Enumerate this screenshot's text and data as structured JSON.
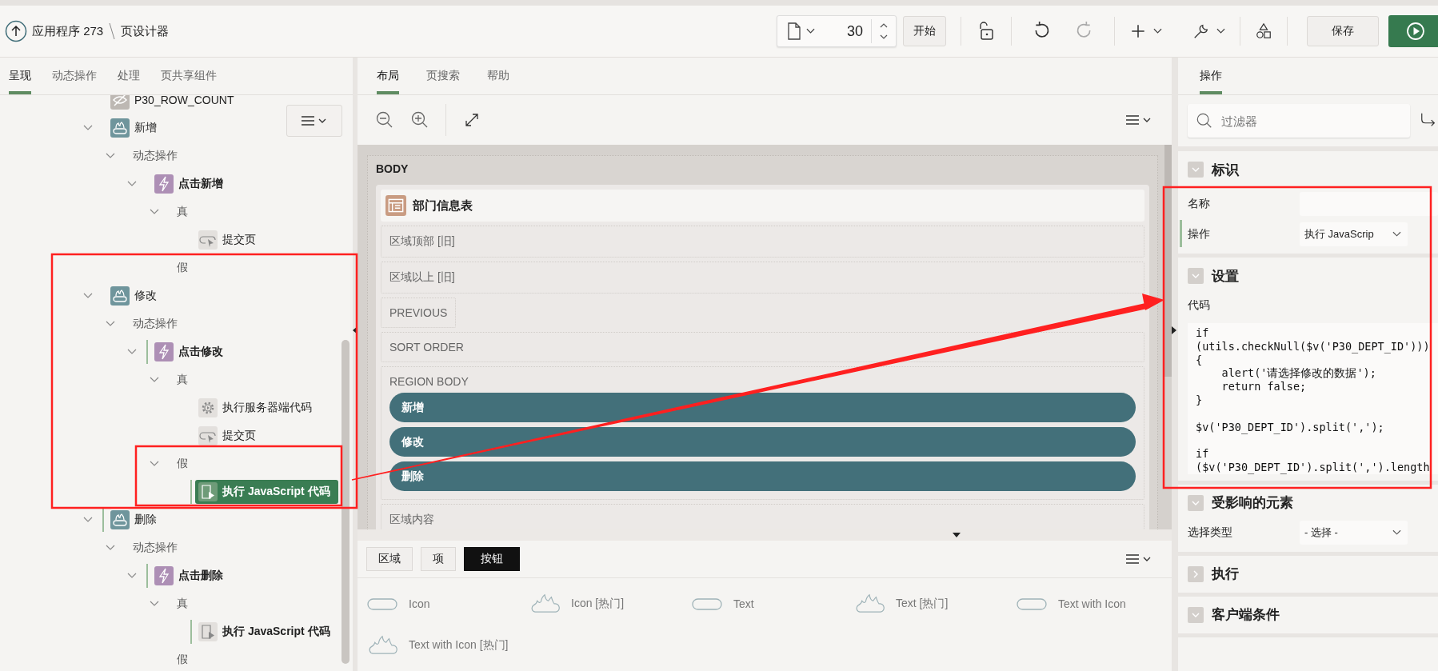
{
  "header": {
    "app": "应用程序 273",
    "page_designer": "页设计器",
    "page_number": "30",
    "start_button": "开始",
    "save_button": "保存",
    "history": [
      {
        "kind": "undo",
        "disabled": false
      },
      {
        "kind": "redo",
        "disabled": true
      }
    ]
  },
  "left_panel": {
    "tabs": [
      {
        "label": "呈现",
        "selected": true
      },
      {
        "label": "动态操作",
        "selected": false
      },
      {
        "label": "处理",
        "selected": false
      },
      {
        "label": "页共享组件",
        "selected": false
      }
    ],
    "tree": [
      {
        "label": "P30_ROW_COUNT",
        "kind": "hidden-item",
        "selected": false,
        "modified": false
      },
      {
        "label": "新增",
        "kind": "button",
        "expanded": true,
        "selected": false,
        "modified": false,
        "children": [
          {
            "label": "动态操作",
            "kind": "folder",
            "expanded": true,
            "selected": false,
            "modified": false,
            "children": [
              {
                "label": "点击新增",
                "kind": "event",
                "expanded": true,
                "selected": false,
                "modified": false,
                "children": [
                  {
                    "label": "真",
                    "kind": "folder",
                    "expanded": true,
                    "selected": false,
                    "modified": false,
                    "children": [
                      {
                        "label": "提交页",
                        "kind": "submit",
                        "selected": false,
                        "modified": false
                      }
                    ]
                  },
                  {
                    "label": "假",
                    "kind": "folder",
                    "selected": false,
                    "modified": false
                  }
                ]
              }
            ]
          }
        ]
      },
      {
        "label": "修改",
        "kind": "button",
        "expanded": true,
        "selected": false,
        "modified": false,
        "children": [
          {
            "label": "动态操作",
            "kind": "folder",
            "expanded": true,
            "selected": false,
            "modified": false,
            "children": [
              {
                "label": "点击修改",
                "kind": "event",
                "expanded": true,
                "selected": false,
                "modified": true,
                "children": [
                  {
                    "label": "真",
                    "kind": "folder",
                    "expanded": true,
                    "selected": false,
                    "modified": false,
                    "children": [
                      {
                        "label": "执行服务器端代码",
                        "kind": "server",
                        "selected": false,
                        "modified": false
                      },
                      {
                        "label": "提交页",
                        "kind": "submit",
                        "selected": false,
                        "modified": false
                      }
                    ]
                  },
                  {
                    "label": "假",
                    "kind": "folder",
                    "expanded": true,
                    "selected": false,
                    "modified": false,
                    "children": [
                      {
                        "label": "执行 JavaScript 代码",
                        "kind": "js",
                        "selected": true,
                        "modified": true
                      }
                    ]
                  }
                ]
              }
            ]
          }
        ]
      },
      {
        "label": "删除",
        "kind": "button",
        "expanded": true,
        "selected": false,
        "modified": true,
        "children": [
          {
            "label": "动态操作",
            "kind": "folder",
            "expanded": true,
            "selected": false,
            "modified": false,
            "children": [
              {
                "label": "点击删除",
                "kind": "event",
                "expanded": true,
                "selected": false,
                "modified": true,
                "children": [
                  {
                    "label": "真",
                    "kind": "folder",
                    "expanded": true,
                    "selected": false,
                    "modified": false,
                    "children": [
                      {
                        "label": "执行 JavaScript 代码",
                        "kind": "js",
                        "selected": false,
                        "modified": true
                      }
                    ]
                  },
                  {
                    "label": "假",
                    "kind": "folder",
                    "selected": false,
                    "modified": false
                  }
                ]
              }
            ]
          }
        ]
      }
    ]
  },
  "layout": {
    "tabs": [
      {
        "label": "布局",
        "selected": true
      },
      {
        "label": "页搜索",
        "selected": false
      },
      {
        "label": "帮助",
        "selected": false
      }
    ],
    "canvas": {
      "body_label": "BODY",
      "region_title": "部门信息表",
      "slots": [
        {
          "label": "区域顶部 [旧]",
          "kind": "wide"
        },
        {
          "label": "区域以上 [旧]",
          "kind": "wide"
        },
        {
          "label": "PREVIOUS",
          "kind": "compact"
        },
        {
          "label": "SORT ORDER",
          "kind": "wide"
        },
        {
          "label": "REGION BODY",
          "kind": "wide",
          "buttons": [
            "新增",
            "修改",
            "删除"
          ]
        },
        {
          "label": "区域内容",
          "kind": "wide"
        }
      ]
    },
    "gallery": {
      "tabs": [
        {
          "label": "区域",
          "selected": false
        },
        {
          "label": "项",
          "selected": false
        },
        {
          "label": "按钮",
          "selected": true
        }
      ],
      "items": [
        {
          "label": "Icon",
          "kind": "plain"
        },
        {
          "label": "Icon [热门]",
          "kind": "hot"
        },
        {
          "label": "Text",
          "kind": "plain"
        },
        {
          "label": "Text [热门]",
          "kind": "hot"
        },
        {
          "label": "Text with Icon",
          "kind": "plain"
        },
        {
          "label": "Text with Icon [热门]",
          "kind": "hot"
        }
      ]
    }
  },
  "properties": {
    "tabs": [
      {
        "label": "操作",
        "selected": true
      }
    ],
    "filter": {
      "placeholder": "过滤器"
    },
    "sections": [
      {
        "title": "标识",
        "expanded": true,
        "fields": [
          {
            "label": "名称",
            "kind": "text",
            "modified": false
          },
          {
            "label": "操作",
            "kind": "select",
            "value": "执行 JavaScrip",
            "modified": true
          }
        ]
      },
      {
        "title": "设置",
        "expanded": true,
        "fields": [
          {
            "label": "代码",
            "kind": "code",
            "modified": false,
            "value": "if\n(utils.checkNull($v('P30_DEPT_ID')))\n{\n    alert('请选择修改的数据');\n    return false;\n}\n\n$v('P30_DEPT_ID').split(',');\n\nif\n($v('P30_DEPT_ID').split(',').length"
          }
        ]
      },
      {
        "title": "受影响的元素",
        "expanded": true,
        "fields": [
          {
            "label": "选择类型",
            "kind": "select",
            "value": "- 选择 -",
            "modified": false
          }
        ]
      },
      {
        "title": "执行",
        "expanded": false
      },
      {
        "title": "客户端条件",
        "expanded": true
      }
    ]
  }
}
